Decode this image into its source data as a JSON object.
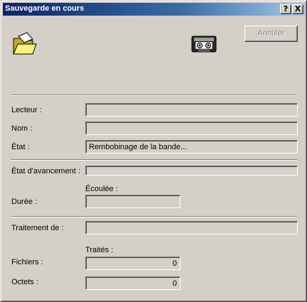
{
  "window": {
    "title": "Sauvegarde en cours",
    "help_glyph": "?",
    "close_glyph": "X"
  },
  "icons": {
    "folder": "open-folder-icon",
    "tape": "tape-cassette-icon"
  },
  "buttons": {
    "cancel_label": "Annuler"
  },
  "fields": {
    "drive": {
      "label": "Lecteur :",
      "value": ""
    },
    "name": {
      "label": "Nom :",
      "value": ""
    },
    "state": {
      "label": "État :",
      "value": "Rembobinage de la bande..."
    }
  },
  "progress": {
    "label": "État d'avancement :",
    "value": 0
  },
  "duration": {
    "label": "Durée :",
    "elapsed_header": "Écoulée :",
    "elapsed_value": ""
  },
  "processing": {
    "label": "Traitement de :",
    "value": ""
  },
  "counts": {
    "processed_header": "Traités :",
    "files_label": "Fichiers :",
    "files_value": "0",
    "bytes_label": "Octets :",
    "bytes_value": "0"
  }
}
